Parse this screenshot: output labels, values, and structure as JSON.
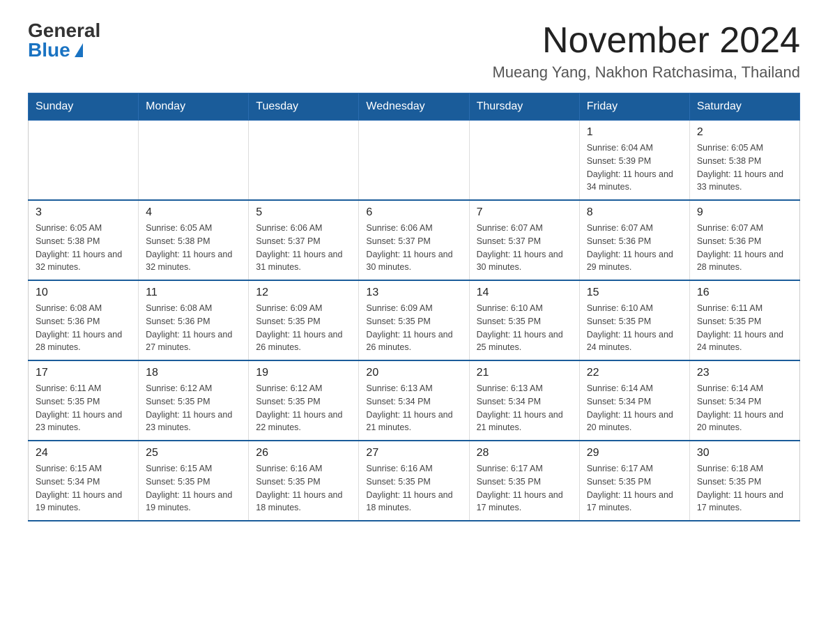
{
  "logo": {
    "general": "General",
    "blue": "Blue"
  },
  "title": "November 2024",
  "subtitle": "Mueang Yang, Nakhon Ratchasima, Thailand",
  "days_of_week": [
    "Sunday",
    "Monday",
    "Tuesday",
    "Wednesday",
    "Thursday",
    "Friday",
    "Saturday"
  ],
  "weeks": [
    [
      {
        "day": "",
        "info": ""
      },
      {
        "day": "",
        "info": ""
      },
      {
        "day": "",
        "info": ""
      },
      {
        "day": "",
        "info": ""
      },
      {
        "day": "",
        "info": ""
      },
      {
        "day": "1",
        "info": "Sunrise: 6:04 AM\nSunset: 5:39 PM\nDaylight: 11 hours and 34 minutes."
      },
      {
        "day": "2",
        "info": "Sunrise: 6:05 AM\nSunset: 5:38 PM\nDaylight: 11 hours and 33 minutes."
      }
    ],
    [
      {
        "day": "3",
        "info": "Sunrise: 6:05 AM\nSunset: 5:38 PM\nDaylight: 11 hours and 32 minutes."
      },
      {
        "day": "4",
        "info": "Sunrise: 6:05 AM\nSunset: 5:38 PM\nDaylight: 11 hours and 32 minutes."
      },
      {
        "day": "5",
        "info": "Sunrise: 6:06 AM\nSunset: 5:37 PM\nDaylight: 11 hours and 31 minutes."
      },
      {
        "day": "6",
        "info": "Sunrise: 6:06 AM\nSunset: 5:37 PM\nDaylight: 11 hours and 30 minutes."
      },
      {
        "day": "7",
        "info": "Sunrise: 6:07 AM\nSunset: 5:37 PM\nDaylight: 11 hours and 30 minutes."
      },
      {
        "day": "8",
        "info": "Sunrise: 6:07 AM\nSunset: 5:36 PM\nDaylight: 11 hours and 29 minutes."
      },
      {
        "day": "9",
        "info": "Sunrise: 6:07 AM\nSunset: 5:36 PM\nDaylight: 11 hours and 28 minutes."
      }
    ],
    [
      {
        "day": "10",
        "info": "Sunrise: 6:08 AM\nSunset: 5:36 PM\nDaylight: 11 hours and 28 minutes."
      },
      {
        "day": "11",
        "info": "Sunrise: 6:08 AM\nSunset: 5:36 PM\nDaylight: 11 hours and 27 minutes."
      },
      {
        "day": "12",
        "info": "Sunrise: 6:09 AM\nSunset: 5:35 PM\nDaylight: 11 hours and 26 minutes."
      },
      {
        "day": "13",
        "info": "Sunrise: 6:09 AM\nSunset: 5:35 PM\nDaylight: 11 hours and 26 minutes."
      },
      {
        "day": "14",
        "info": "Sunrise: 6:10 AM\nSunset: 5:35 PM\nDaylight: 11 hours and 25 minutes."
      },
      {
        "day": "15",
        "info": "Sunrise: 6:10 AM\nSunset: 5:35 PM\nDaylight: 11 hours and 24 minutes."
      },
      {
        "day": "16",
        "info": "Sunrise: 6:11 AM\nSunset: 5:35 PM\nDaylight: 11 hours and 24 minutes."
      }
    ],
    [
      {
        "day": "17",
        "info": "Sunrise: 6:11 AM\nSunset: 5:35 PM\nDaylight: 11 hours and 23 minutes."
      },
      {
        "day": "18",
        "info": "Sunrise: 6:12 AM\nSunset: 5:35 PM\nDaylight: 11 hours and 23 minutes."
      },
      {
        "day": "19",
        "info": "Sunrise: 6:12 AM\nSunset: 5:35 PM\nDaylight: 11 hours and 22 minutes."
      },
      {
        "day": "20",
        "info": "Sunrise: 6:13 AM\nSunset: 5:34 PM\nDaylight: 11 hours and 21 minutes."
      },
      {
        "day": "21",
        "info": "Sunrise: 6:13 AM\nSunset: 5:34 PM\nDaylight: 11 hours and 21 minutes."
      },
      {
        "day": "22",
        "info": "Sunrise: 6:14 AM\nSunset: 5:34 PM\nDaylight: 11 hours and 20 minutes."
      },
      {
        "day": "23",
        "info": "Sunrise: 6:14 AM\nSunset: 5:34 PM\nDaylight: 11 hours and 20 minutes."
      }
    ],
    [
      {
        "day": "24",
        "info": "Sunrise: 6:15 AM\nSunset: 5:34 PM\nDaylight: 11 hours and 19 minutes."
      },
      {
        "day": "25",
        "info": "Sunrise: 6:15 AM\nSunset: 5:35 PM\nDaylight: 11 hours and 19 minutes."
      },
      {
        "day": "26",
        "info": "Sunrise: 6:16 AM\nSunset: 5:35 PM\nDaylight: 11 hours and 18 minutes."
      },
      {
        "day": "27",
        "info": "Sunrise: 6:16 AM\nSunset: 5:35 PM\nDaylight: 11 hours and 18 minutes."
      },
      {
        "day": "28",
        "info": "Sunrise: 6:17 AM\nSunset: 5:35 PM\nDaylight: 11 hours and 17 minutes."
      },
      {
        "day": "29",
        "info": "Sunrise: 6:17 AM\nSunset: 5:35 PM\nDaylight: 11 hours and 17 minutes."
      },
      {
        "day": "30",
        "info": "Sunrise: 6:18 AM\nSunset: 5:35 PM\nDaylight: 11 hours and 17 minutes."
      }
    ]
  ]
}
